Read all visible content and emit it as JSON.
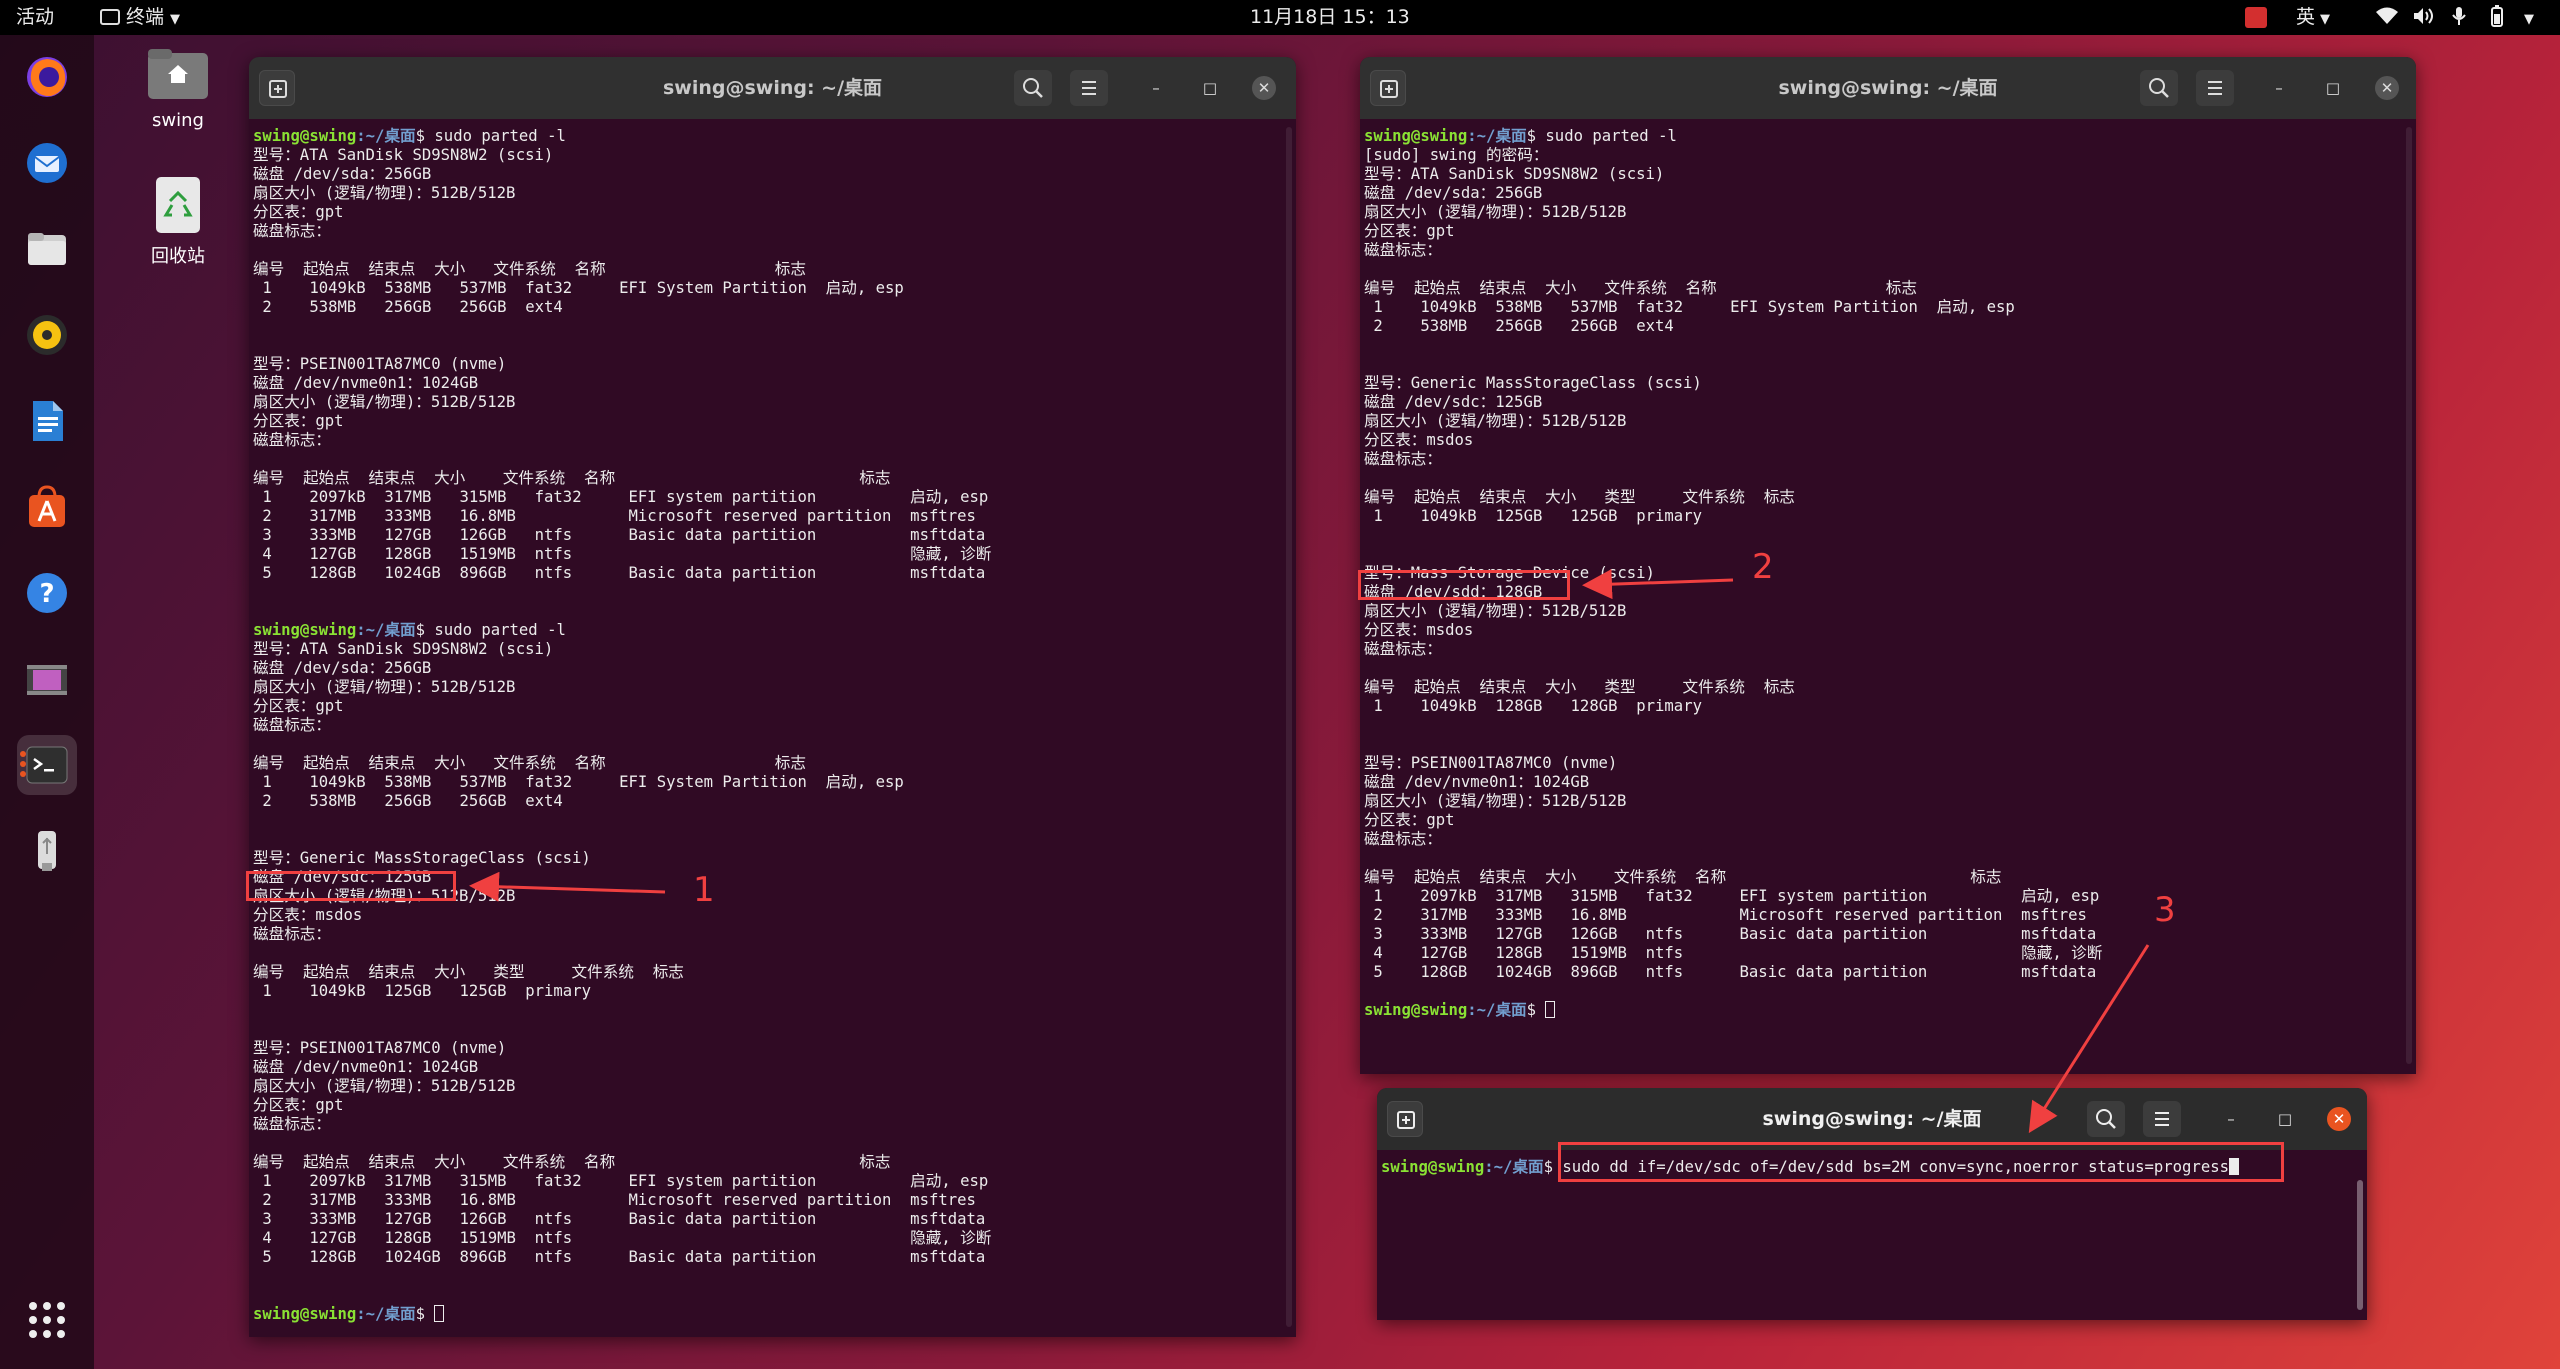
{
  "topbar": {
    "activities": "活动",
    "app_menu": "终端",
    "clock": "11月18日  15：13",
    "input_method": "英"
  },
  "desktop": {
    "home_label": "swing",
    "trash_label": "回收站"
  },
  "window_left": {
    "title": "swing@swing: ~/桌面",
    "lines": [
      {
        "prompt_user": "swing@swing",
        "prompt_path": ":~/桌面",
        "text": "$ sudo parted -l"
      },
      {
        "text": "型号：ATA SanDisk SD9SN8W2 (scsi)"
      },
      {
        "text": "磁盘 /dev/sda：256GB"
      },
      {
        "text": "扇区大小 (逻辑/物理)：512B/512B"
      },
      {
        "text": "分区表：gpt"
      },
      {
        "text": "磁盘标志："
      },
      {
        "text": ""
      },
      {
        "text": "编号  起始点  结束点  大小   文件系统  名称                  标志"
      },
      {
        "text": " 1    1049kB  538MB   537MB  fat32     EFI System Partition  启动, esp"
      },
      {
        "text": " 2    538MB   256GB   256GB  ext4"
      },
      {
        "text": ""
      },
      {
        "text": ""
      },
      {
        "text": "型号：PSEIN001TA87MC0 (nvme)"
      },
      {
        "text": "磁盘 /dev/nvme0n1：1024GB"
      },
      {
        "text": "扇区大小 (逻辑/物理)：512B/512B"
      },
      {
        "text": "分区表：gpt"
      },
      {
        "text": "磁盘标志："
      },
      {
        "text": ""
      },
      {
        "text": "编号  起始点  结束点  大小    文件系统  名称                          标志"
      },
      {
        "text": " 1    2097kB  317MB   315MB   fat32     EFI system partition          启动, esp"
      },
      {
        "text": " 2    317MB   333MB   16.8MB            Microsoft reserved partition  msftres"
      },
      {
        "text": " 3    333MB   127GB   126GB   ntfs      Basic data partition          msftdata"
      },
      {
        "text": " 4    127GB   128GB   1519MB  ntfs                                    隐藏, 诊断"
      },
      {
        "text": " 5    128GB   1024GB  896GB   ntfs      Basic data partition          msftdata"
      },
      {
        "text": ""
      },
      {
        "text": ""
      },
      {
        "prompt_user": "swing@swing",
        "prompt_path": ":~/桌面",
        "text": "$ sudo parted -l"
      },
      {
        "text": "型号：ATA SanDisk SD9SN8W2 (scsi)"
      },
      {
        "text": "磁盘 /dev/sda：256GB"
      },
      {
        "text": "扇区大小 (逻辑/物理)：512B/512B"
      },
      {
        "text": "分区表：gpt"
      },
      {
        "text": "磁盘标志："
      },
      {
        "text": ""
      },
      {
        "text": "编号  起始点  结束点  大小   文件系统  名称                  标志"
      },
      {
        "text": " 1    1049kB  538MB   537MB  fat32     EFI System Partition  启动, esp"
      },
      {
        "text": " 2    538MB   256GB   256GB  ext4"
      },
      {
        "text": ""
      },
      {
        "text": ""
      },
      {
        "text": "型号：Generic MassStorageClass (scsi)"
      },
      {
        "text": "磁盘 /dev/sdc：125GB"
      },
      {
        "text": "扇区大小 (逻辑/物理)：512B/512B"
      },
      {
        "text": "分区表：msdos"
      },
      {
        "text": "磁盘标志："
      },
      {
        "text": ""
      },
      {
        "text": "编号  起始点  结束点  大小   类型     文件系统  标志"
      },
      {
        "text": " 1    1049kB  125GB   125GB  primary"
      },
      {
        "text": ""
      },
      {
        "text": ""
      },
      {
        "text": "型号：PSEIN001TA87MC0 (nvme)"
      },
      {
        "text": "磁盘 /dev/nvme0n1：1024GB"
      },
      {
        "text": "扇区大小 (逻辑/物理)：512B/512B"
      },
      {
        "text": "分区表：gpt"
      },
      {
        "text": "磁盘标志："
      },
      {
        "text": ""
      },
      {
        "text": "编号  起始点  结束点  大小    文件系统  名称                          标志"
      },
      {
        "text": " 1    2097kB  317MB   315MB   fat32     EFI system partition          启动, esp"
      },
      {
        "text": " 2    317MB   333MB   16.8MB            Microsoft reserved partition  msftres"
      },
      {
        "text": " 3    333MB   127GB   126GB   ntfs      Basic data partition          msftdata"
      },
      {
        "text": " 4    127GB   128GB   1519MB  ntfs                                    隐藏, 诊断"
      },
      {
        "text": " 5    128GB   1024GB  896GB   ntfs      Basic data partition          msftdata"
      },
      {
        "text": ""
      },
      {
        "text": ""
      },
      {
        "prompt_user": "swing@swing",
        "prompt_path": ":~/桌面",
        "text": "$ ",
        "cursor": true
      }
    ]
  },
  "window_right": {
    "title": "swing@swing: ~/桌面",
    "lines": [
      {
        "prompt_user": "swing@swing",
        "prompt_path": ":~/桌面",
        "text": "$ sudo parted -l"
      },
      {
        "text": "[sudo] swing 的密码："
      },
      {
        "text": "型号：ATA SanDisk SD9SN8W2 (scsi)"
      },
      {
        "text": "磁盘 /dev/sda：256GB"
      },
      {
        "text": "扇区大小 (逻辑/物理)：512B/512B"
      },
      {
        "text": "分区表：gpt"
      },
      {
        "text": "磁盘标志："
      },
      {
        "text": ""
      },
      {
        "text": "编号  起始点  结束点  大小   文件系统  名称                  标志"
      },
      {
        "text": " 1    1049kB  538MB   537MB  fat32     EFI System Partition  启动, esp"
      },
      {
        "text": " 2    538MB   256GB   256GB  ext4"
      },
      {
        "text": ""
      },
      {
        "text": ""
      },
      {
        "text": "型号：Generic MassStorageClass (scsi)"
      },
      {
        "text": "磁盘 /dev/sdc：125GB"
      },
      {
        "text": "扇区大小 (逻辑/物理)：512B/512B"
      },
      {
        "text": "分区表：msdos"
      },
      {
        "text": "磁盘标志："
      },
      {
        "text": ""
      },
      {
        "text": "编号  起始点  结束点  大小   类型     文件系统  标志"
      },
      {
        "text": " 1    1049kB  125GB   125GB  primary"
      },
      {
        "text": ""
      },
      {
        "text": ""
      },
      {
        "text": "型号：Mass Storage Device (scsi)"
      },
      {
        "text": "磁盘 /dev/sdd：128GB"
      },
      {
        "text": "扇区大小 (逻辑/物理)：512B/512B"
      },
      {
        "text": "分区表：msdos"
      },
      {
        "text": "磁盘标志："
      },
      {
        "text": ""
      },
      {
        "text": "编号  起始点  结束点  大小   类型     文件系统  标志"
      },
      {
        "text": " 1    1049kB  128GB   128GB  primary"
      },
      {
        "text": ""
      },
      {
        "text": ""
      },
      {
        "text": "型号：PSEIN001TA87MC0 (nvme)"
      },
      {
        "text": "磁盘 /dev/nvme0n1：1024GB"
      },
      {
        "text": "扇区大小 (逻辑/物理)：512B/512B"
      },
      {
        "text": "分区表：gpt"
      },
      {
        "text": "磁盘标志："
      },
      {
        "text": ""
      },
      {
        "text": "编号  起始点  结束点  大小    文件系统  名称                          标志"
      },
      {
        "text": " 1    2097kB  317MB   315MB   fat32     EFI system partition          启动, esp"
      },
      {
        "text": " 2    317MB   333MB   16.8MB            Microsoft reserved partition  msftres"
      },
      {
        "text": " 3    333MB   127GB   126GB   ntfs      Basic data partition          msftdata"
      },
      {
        "text": " 4    127GB   128GB   1519MB  ntfs                                    隐藏, 诊断"
      },
      {
        "text": " 5    128GB   1024GB  896GB   ntfs      Basic data partition          msftdata"
      },
      {
        "text": ""
      },
      {
        "prompt_user": "swing@swing",
        "prompt_path": ":~/桌面",
        "text": "$ ",
        "cursor": true
      }
    ]
  },
  "window_small": {
    "title": "swing@swing: ~/桌面",
    "lines": [
      {
        "prompt_user": "swing@swing",
        "prompt_path": ":~/桌面",
        "text": "$ sudo dd if=/dev/sdc of=/dev/sdd bs=2M conv=sync,noerror status=progress",
        "cursor": true,
        "cursor_solid": true
      }
    ]
  },
  "annotations": {
    "a1": "1",
    "a2": "2",
    "a3": "3"
  },
  "colors": {
    "terminal_bg": "#300a24",
    "prompt_user": "#8ae234",
    "prompt_path": "#729fcf",
    "annotation": "#f04040",
    "accent": "#e95420"
  }
}
